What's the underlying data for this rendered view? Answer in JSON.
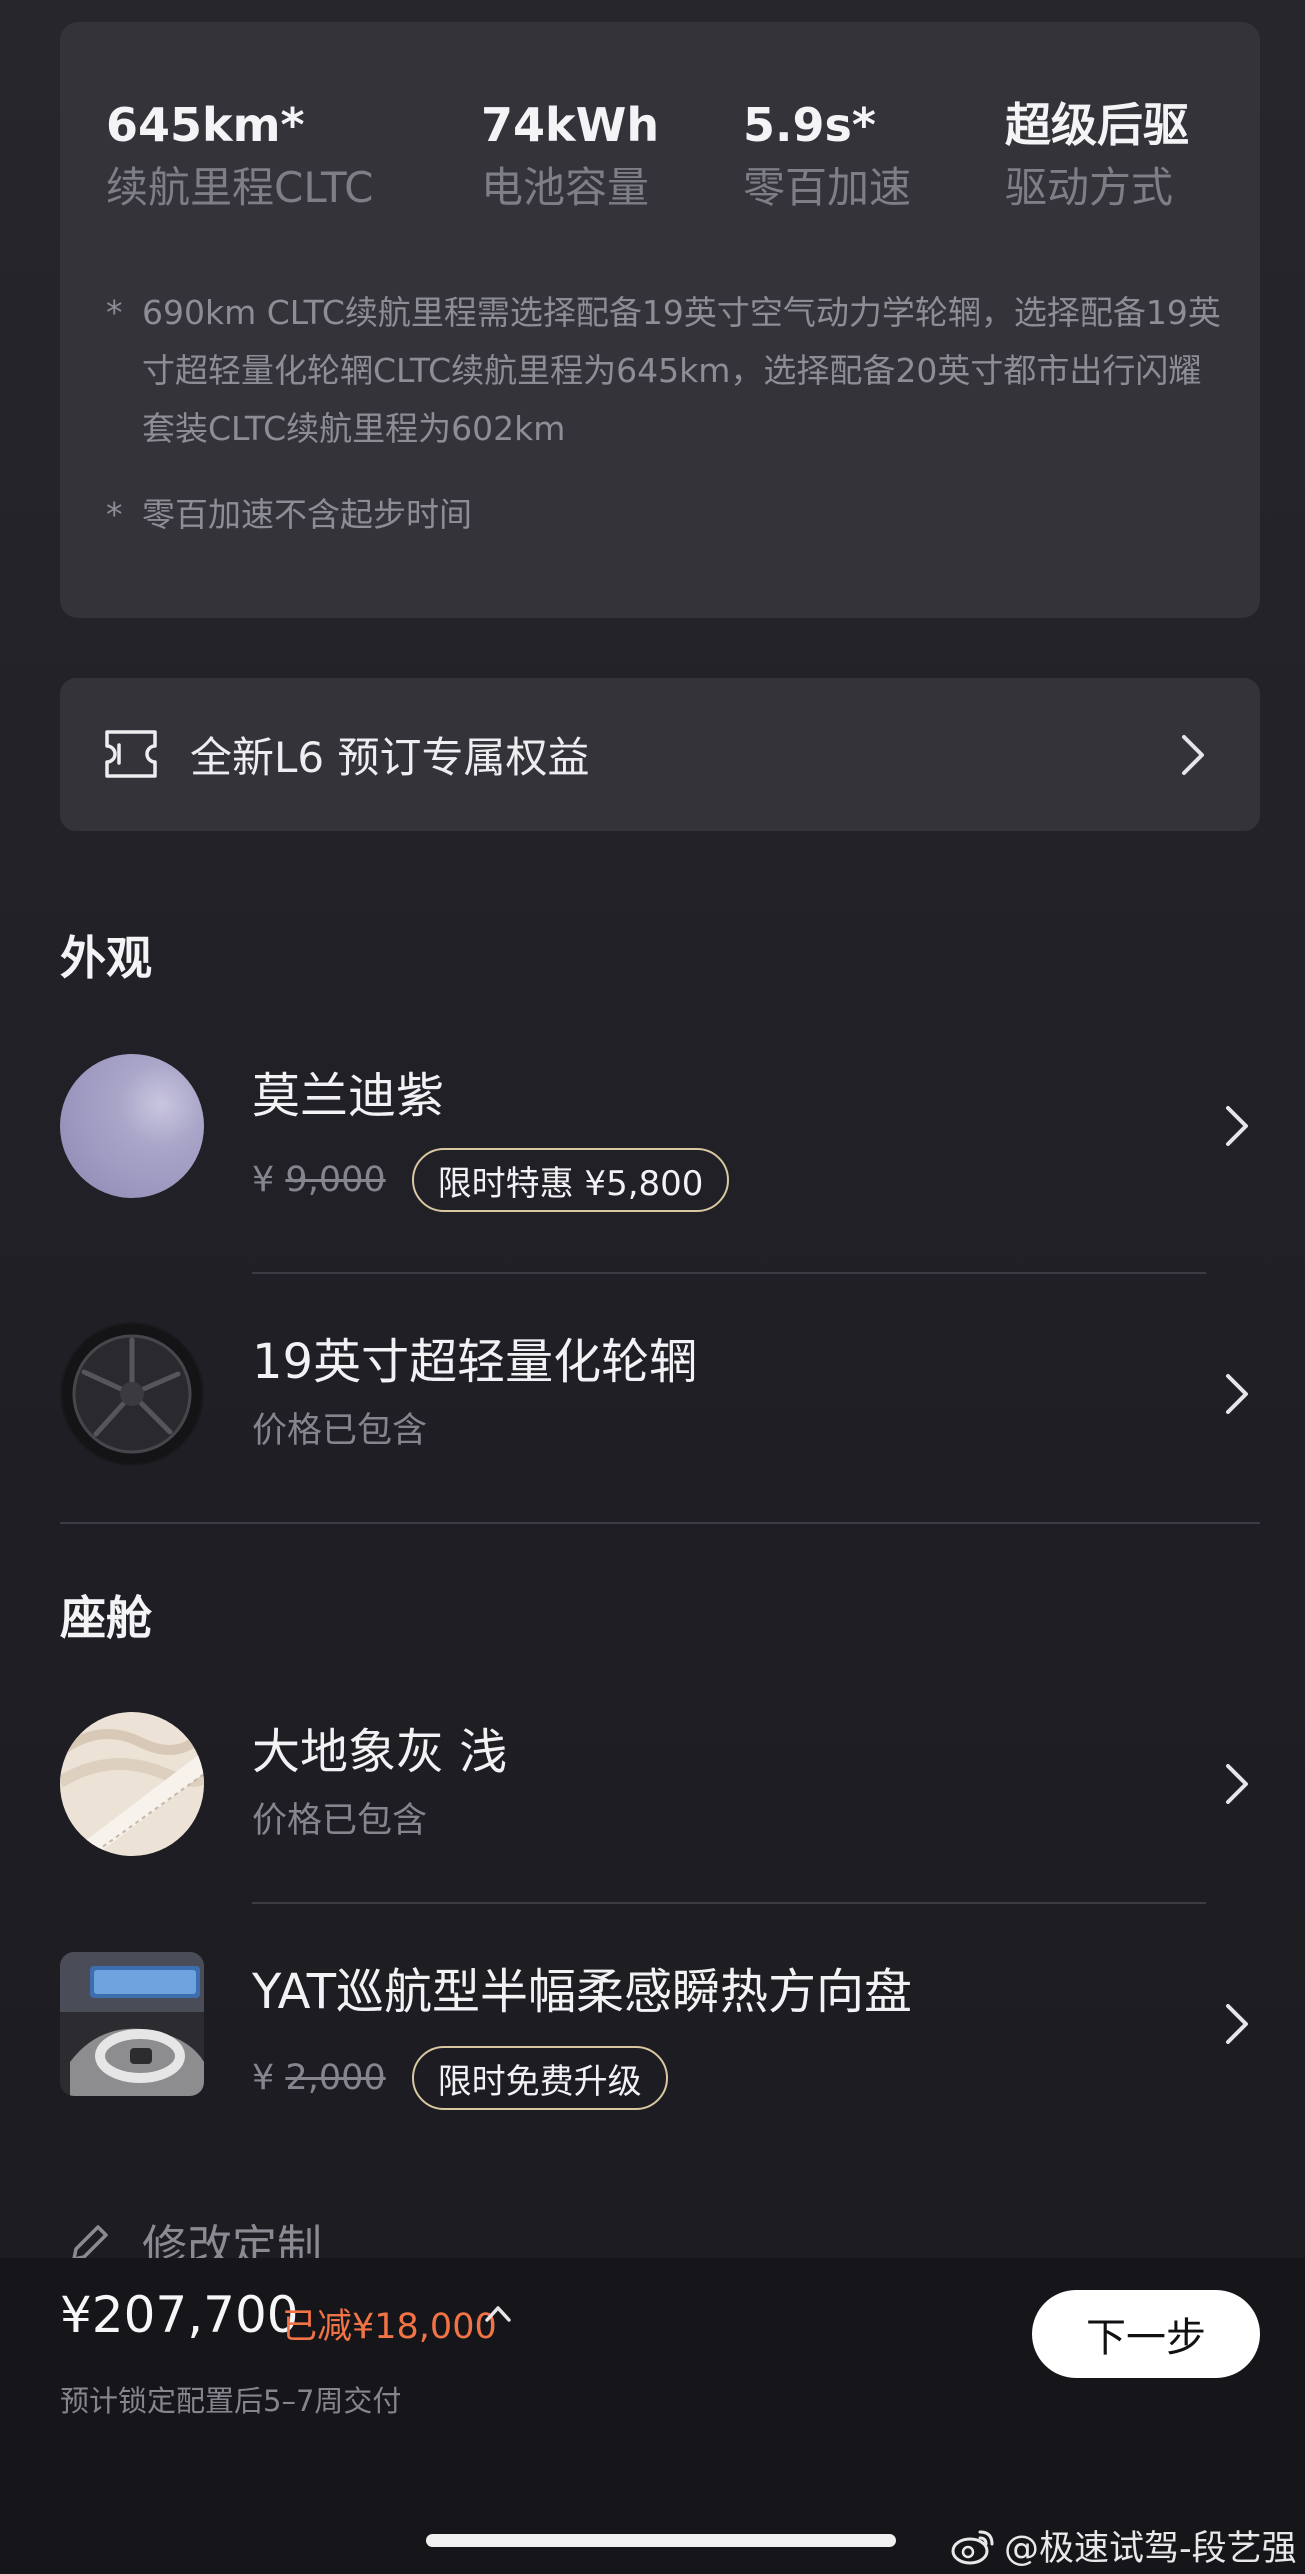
{
  "specs": {
    "items": [
      {
        "value": "645km*",
        "label": "续航里程CLTC"
      },
      {
        "value": "74kWh",
        "label": "电池容量"
      },
      {
        "value": "5.9s*",
        "label": "零百加速"
      },
      {
        "value": "超级后驱",
        "label": "驱动方式"
      }
    ],
    "note_marker": "*",
    "notes": [
      "690km CLTC续航里程需选择配备19英寸空气动力学轮辋，选择配备19英寸超轻量化轮辋CLTC续航里程为645km，选择配备20英寸都市出行闪耀套装CLTC续航里程为602km",
      "零百加速不含起步时间"
    ]
  },
  "benefit": {
    "label": "全新L6 预订专属权益",
    "icon": "ticket-icon"
  },
  "exterior": {
    "title": "外观",
    "options": [
      {
        "name": "莫兰迪紫",
        "currency": "¥",
        "old_price": "9,000",
        "promo": "限时特惠 ¥5,800",
        "swatch_color": "#a7a3c6"
      },
      {
        "name": "19英寸超轻量化轮辋",
        "sub": "价格已包含"
      }
    ]
  },
  "cabin": {
    "title": "座舱",
    "options": [
      {
        "name": "大地象灰 浅",
        "sub": "价格已包含"
      },
      {
        "name": "YAT巡航型半幅柔感瞬热方向盘",
        "currency": "¥",
        "old_price": "2,000",
        "promo": "限时免费升级"
      }
    ]
  },
  "edit": {
    "label": "修改定制",
    "icon": "pencil-icon"
  },
  "footer": {
    "total": "¥207,700",
    "saved": "已减¥18,000",
    "delivery": "预计锁定配置后5–7周交付",
    "next_label": "下一步"
  },
  "watermark": "@极速试驾-段艺强",
  "colors": {
    "accent_orange": "#f27346",
    "promo_border": "#d8c7a0",
    "card_bg": "#333339"
  }
}
